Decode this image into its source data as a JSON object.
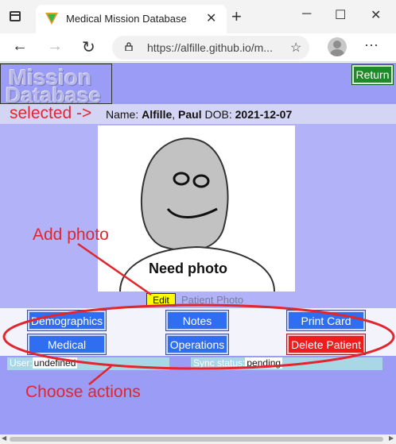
{
  "browser": {
    "tab_title": "Medical Mission Database",
    "tab_close": "✕",
    "new_tab": "+",
    "minimize": "─",
    "maximize": "☐",
    "close": "✕",
    "url": "https://alfille.github.io/m...",
    "more": "···"
  },
  "app": {
    "logo_line1": "Mission",
    "logo_line2": "Database",
    "return_label": "Return"
  },
  "patient": {
    "name_label": "Name: ",
    "last_name": "Alfille",
    "first_name": "Paul",
    "dob_label": "DOB: ",
    "dob": "2021-12-07"
  },
  "photo": {
    "placeholder_text": "Need photo",
    "edit_label": "Edit",
    "caption": "Patient Photo"
  },
  "actions": {
    "demographics": "Demographics",
    "notes": "Notes",
    "print_card": "Print Card",
    "medical": "Medical",
    "operations": "Operations",
    "delete_patient": "Delete Patient"
  },
  "status": {
    "user_label": "User:",
    "user_value": "undefined",
    "sync_label": "Sync status:",
    "sync_value": "pending"
  },
  "annotations": {
    "selected": "selected ->",
    "add_photo": "Add photo",
    "choose_actions": "Choose actions"
  },
  "colors": {
    "page_bg": "#9a9cf6",
    "action_button": "#2f6ef0",
    "delete_button": "#ee1c1c",
    "return_button": "#1e8a2a",
    "annotation": "#e0262f"
  }
}
